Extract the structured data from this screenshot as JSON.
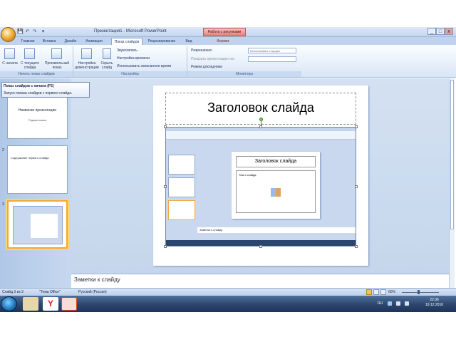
{
  "window": {
    "title": "Презентация1 - Microsoft PowerPoint",
    "context_tab": "Работа с рисунками",
    "min": "_",
    "max": "□",
    "close": "x"
  },
  "quick_access": [
    "💾",
    "↶",
    "↷",
    "▾"
  ],
  "tabs": [
    "Главная",
    "Вставка",
    "Дизайн",
    "Анимация",
    "Показ слайдов",
    "Рецензирование",
    "Вид",
    "Формат"
  ],
  "ribbon": {
    "buttons": [
      {
        "label": "С начала",
        "icon": "play-from-start-icon"
      },
      {
        "label": "С текущего слайда",
        "icon": "play-from-current-icon"
      },
      {
        "label": "Произвольный показ",
        "icon": "custom-show-icon"
      },
      {
        "label": "Настройка демонстрации",
        "icon": "setup-show-icon"
      },
      {
        "label": "Скрыть слайд",
        "icon": "hide-slide-icon"
      }
    ],
    "options": [
      "Звукозапись",
      "Настройка времени",
      "Использовать записанное время"
    ],
    "monitor_label": "Разрешение:",
    "resolution_value": "Использовать текущее",
    "show_on_label": "Показать презентацию на:",
    "presenter_label": "Режим докладчика",
    "groups": [
      "Начать показ слайдов",
      "Настройка",
      "Мониторы"
    ]
  },
  "tooltip": {
    "title": "Показ слайдов с начала (F5)",
    "body": "Запуск показа слайдов с первого слайда."
  },
  "thumbnails": [
    {
      "num": "",
      "title": "Название презентации",
      "sub": "Подзаголовок"
    },
    {
      "num": "2",
      "title": "Содержание первого слайда",
      "sub": ""
    },
    {
      "num": "3",
      "title": "",
      "sub": ""
    }
  ],
  "slide": {
    "title": "Заголовок слайда",
    "inner_title": "Заголовок слайда",
    "inner_bullet": "Текст слайда",
    "inner_notes": "Заметки к слайду"
  },
  "notes": "Заметки к слайду",
  "status": {
    "slide": "Слайд 3 из 3",
    "theme": "\"Тема Office\"",
    "lang": "Русский (Россия)",
    "zoom": "60%"
  },
  "taskbar": {
    "lang": "RU",
    "time": "22:36",
    "date": "19.12.2016"
  },
  "colors": {
    "accent": "#f1a93b",
    "ribbon": "#d9e6f6",
    "taskbar": "#2b466e"
  }
}
